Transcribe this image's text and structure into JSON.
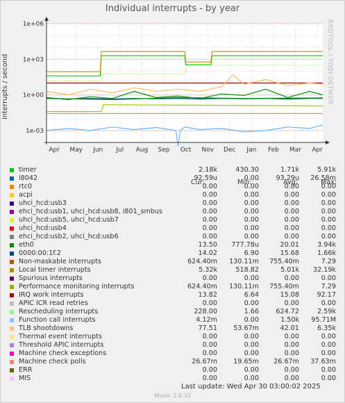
{
  "title": "Individual interrupts - by year",
  "ylabel": "interrupts / second",
  "watermark": "RRDTOOL / TOBI OETIKER",
  "chart_data": {
    "type": "line",
    "yscale": "log",
    "ylim": [
      0.0001,
      1000000
    ],
    "y_ticks": [
      {
        "value": 1000000,
        "label": "1e+06"
      },
      {
        "value": 1000,
        "label": "1e+03"
      },
      {
        "value": 1,
        "label": "1e+00"
      },
      {
        "value": 0.001,
        "label": "1e-03"
      }
    ],
    "x_ticks": [
      "Apr",
      "May",
      "Jun",
      "Jul",
      "Aug",
      "Sep",
      "Oct",
      "Nov",
      "Dec",
      "Jan",
      "Feb",
      "Mar",
      "Apr"
    ],
    "x_range_months": [
      0,
      12.6
    ],
    "grid": true,
    "series": [
      {
        "name": "timer",
        "color": "#00cc00",
        "x": [
          0,
          2.45,
          2.5,
          6.3,
          6.35,
          7.5,
          7.55,
          12.6
        ],
        "y": [
          40,
          40,
          2000,
          2000,
          350,
          350,
          2000,
          2000
        ]
      },
      {
        "name": "Local timer interrupts",
        "color": "#cc9900",
        "x": [
          0,
          2.45,
          2.5,
          6.3,
          6.35,
          7.5,
          7.55,
          12.6
        ],
        "y": [
          90,
          90,
          4500,
          4500,
          600,
          600,
          4500,
          4500
        ]
      },
      {
        "name": "eth0",
        "color": "#008f00",
        "x": [
          0,
          1,
          2,
          3,
          4,
          5,
          6,
          7,
          8,
          9,
          10,
          11,
          12,
          12.6
        ],
        "y": [
          0.6,
          0.4,
          0.7,
          0.5,
          2,
          0.6,
          0.8,
          0.5,
          1.2,
          0.9,
          3,
          0.6,
          2,
          1
        ]
      },
      {
        "name": "0000:00:1f.2",
        "color": "#00487d",
        "x": [
          0,
          1,
          2,
          3,
          4,
          5,
          6,
          7,
          8,
          9,
          10,
          11,
          12,
          12.6
        ],
        "y": [
          0.5,
          0.45,
          0.5,
          0.45,
          0.5,
          0.48,
          0.5,
          0.45,
          0.5,
          0.47,
          0.5,
          0.45,
          0.5,
          0.5
        ]
      },
      {
        "name": "Non-maskable interrupts",
        "color": "#008f00",
        "x": [
          0,
          3,
          6,
          9,
          12.6
        ],
        "y": [
          0.5,
          0.4,
          0.6,
          0.5,
          0.55
        ]
      },
      {
        "name": "Rescheduling interrupts",
        "color": "#ccff99",
        "x": [
          0,
          2.5,
          2.6,
          6.3,
          6.4,
          12.6
        ],
        "y": [
          15,
          15,
          60,
          60,
          300,
          300
        ]
      },
      {
        "name": "IRQ work interrupts",
        "color": "#990000",
        "x": [
          0,
          12.6
        ],
        "y": [
          10,
          10
        ]
      },
      {
        "name": "Performance monitoring interrupts",
        "color": "#99cc00",
        "x": [
          0,
          2.5,
          2.6,
          12.6
        ],
        "y": [
          0.04,
          0.04,
          0.15,
          0.12
        ]
      },
      {
        "name": "Function call interrupts",
        "color": "#66b2ff",
        "x": [
          0,
          1,
          2,
          3,
          4,
          5,
          5.9,
          6.0,
          6.1,
          6.3,
          7,
          8,
          9,
          10,
          11,
          12,
          12.6
        ],
        "y": [
          0.001,
          0.0015,
          0.001,
          0.002,
          0.0012,
          0.0018,
          0.001,
          5e-05,
          0.001,
          0.002,
          0.0012,
          0.0015,
          0.0008,
          0.001,
          0.002,
          0.0015,
          0.003
        ]
      },
      {
        "name": "TLB shootdowns",
        "color": "#ffbb66",
        "x": [
          0,
          1,
          2,
          3,
          4,
          5,
          6,
          7,
          8,
          8.5,
          9,
          10,
          11,
          12,
          12.6
        ],
        "y": [
          2,
          1,
          3,
          1.5,
          4,
          2,
          3,
          2,
          5,
          50,
          8,
          20,
          6,
          10,
          8
        ]
      },
      {
        "name": "Machine check polls",
        "color": "#ee8888",
        "x": [
          0,
          12.6
        ],
        "y": [
          0.027,
          0.027
        ]
      }
    ]
  },
  "legend": {
    "headers": [
      "Cur:",
      "Min:",
      "Avg:",
      "Max:"
    ],
    "rows": [
      {
        "label": "timer",
        "color": "#00cc00",
        "cur": "2.18k",
        "min": "430.30",
        "avg": "1.71k",
        "max": "5.91k"
      },
      {
        "label": "i8042",
        "color": "#0066b3",
        "cur": "92.59u",
        "min": "0.00",
        "avg": "93.29u",
        "max": "26.58m"
      },
      {
        "label": "rtc0",
        "color": "#ff8000",
        "cur": "0.00",
        "min": "0.00",
        "avg": "0.00",
        "max": "0.00"
      },
      {
        "label": "acpi",
        "color": "#ffcc00",
        "cur": "0.00",
        "min": "0.00",
        "avg": "0.00",
        "max": "0.00"
      },
      {
        "label": "uhci_hcd:usb3",
        "color": "#330099",
        "cur": "0.00",
        "min": "0.00",
        "avg": "0.00",
        "max": "0.00"
      },
      {
        "label": "ehci_hcd:usb1, uhci_hcd:usb8, i801_smbus",
        "color": "#990099",
        "cur": "0.00",
        "min": "0.00",
        "avg": "0.00",
        "max": "0.00"
      },
      {
        "label": "uhci_hcd:usb5, uhci_hcd:usb7",
        "color": "#ccff00",
        "cur": "0.00",
        "min": "0.00",
        "avg": "0.00",
        "max": "0.00"
      },
      {
        "label": "uhci_hcd:usb4",
        "color": "#ff0000",
        "cur": "0.00",
        "min": "0.00",
        "avg": "0.00",
        "max": "0.00"
      },
      {
        "label": "ehci_hcd:usb2, uhci_hcd:usb6",
        "color": "#808080",
        "cur": "0.00",
        "min": "0.00",
        "avg": "0.00",
        "max": "0.00"
      },
      {
        "label": "eth0",
        "color": "#008f00",
        "cur": "13.50",
        "min": "777.78u",
        "avg": "20.01",
        "max": "3.94k"
      },
      {
        "label": "0000:00:1f.2",
        "color": "#00487d",
        "cur": "14.02",
        "min": "6.90",
        "avg": "15.68",
        "max": "1.66k"
      },
      {
        "label": "Non-maskable interrupts",
        "color": "#b35a00",
        "cur": "624.40m",
        "min": "130.11m",
        "avg": "755.40m",
        "max": "7.29"
      },
      {
        "label": "Local timer interrupts",
        "color": "#b38f00",
        "cur": "5.32k",
        "min": "518.82",
        "avg": "5.01k",
        "max": "32.19k"
      },
      {
        "label": "Spurious interrupts",
        "color": "#6b006b",
        "cur": "0.00",
        "min": "0.00",
        "avg": "0.00",
        "max": "0.00"
      },
      {
        "label": "Performance monitoring interrupts",
        "color": "#8fb300",
        "cur": "624.40m",
        "min": "130.11m",
        "avg": "755.40m",
        "max": "7.29"
      },
      {
        "label": "IRQ work interrupts",
        "color": "#b30000",
        "cur": "13.82",
        "min": "6.64",
        "avg": "15.08",
        "max": "92.17"
      },
      {
        "label": "APIC ICR read retries",
        "color": "#bebebe",
        "cur": "0.00",
        "min": "0.00",
        "avg": "0.00",
        "max": "0.00"
      },
      {
        "label": "Rescheduling interrupts",
        "color": "#80ff80",
        "cur": "228.00",
        "min": "1.66",
        "avg": "624.72",
        "max": "2.59k"
      },
      {
        "label": "Function call interrupts",
        "color": "#80c9ff",
        "cur": "4.12m",
        "min": "0.00",
        "avg": "1.50k",
        "max": "95.71M"
      },
      {
        "label": "TLB shootdowns",
        "color": "#ffc080",
        "cur": "77.51",
        "min": "53.67m",
        "avg": "42.01",
        "max": "6.35k"
      },
      {
        "label": "Thermal event interrupts",
        "color": "#ffe680",
        "cur": "0.00",
        "min": "0.00",
        "avg": "0.00",
        "max": "0.00"
      },
      {
        "label": "Threshold APIC interrupts",
        "color": "#aa80ff",
        "cur": "0.00",
        "min": "0.00",
        "avg": "0.00",
        "max": "0.00"
      },
      {
        "label": "Machine check exceptions",
        "color": "#ee00cc",
        "cur": "0.00",
        "min": "0.00",
        "avg": "0.00",
        "max": "0.00"
      },
      {
        "label": "Machine check polls",
        "color": "#ff8080",
        "cur": "26.67m",
        "min": "19.65m",
        "avg": "26.67m",
        "max": "37.63m"
      },
      {
        "label": "ERR",
        "color": "#666600",
        "cur": "0.00",
        "min": "0.00",
        "avg": "0.00",
        "max": "0.00"
      },
      {
        "label": "MIS",
        "color": "#ffbfff",
        "cur": "0.00",
        "min": "0.00",
        "avg": "0.00",
        "max": "0.00"
      }
    ]
  },
  "footer": {
    "last_update": "Last update:  Wed Apr 30 03:00:02 2025",
    "version": "Munin 2.0.33"
  }
}
